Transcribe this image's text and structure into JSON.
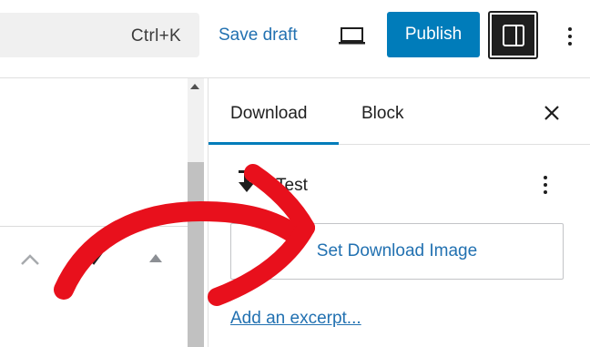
{
  "toolbar": {
    "command_shortcut": "Ctrl+K",
    "save_draft_label": "Save draft",
    "preview_icon": "laptop-icon",
    "publish_label": "Publish",
    "settings_icon": "sidebar-toggle-icon",
    "more_icon": "vertical-ellipsis-icon"
  },
  "sidebar": {
    "tabs": [
      {
        "label": "Download",
        "active": true
      },
      {
        "label": "Block",
        "active": false
      }
    ],
    "close_icon": "close-icon",
    "block": {
      "icon": "download-icon",
      "title": "Test",
      "more_icon": "vertical-ellipsis-icon"
    },
    "set_image_label": "Set Download Image",
    "excerpt_link_label": "Add an excerpt..."
  },
  "editor": {
    "icons": [
      "chevron-up-icon",
      "checkmark-icon",
      "triangle-up-icon"
    ]
  },
  "colors": {
    "accent": "#007cba",
    "link": "#2271b1",
    "annotation": "#e8101c"
  }
}
